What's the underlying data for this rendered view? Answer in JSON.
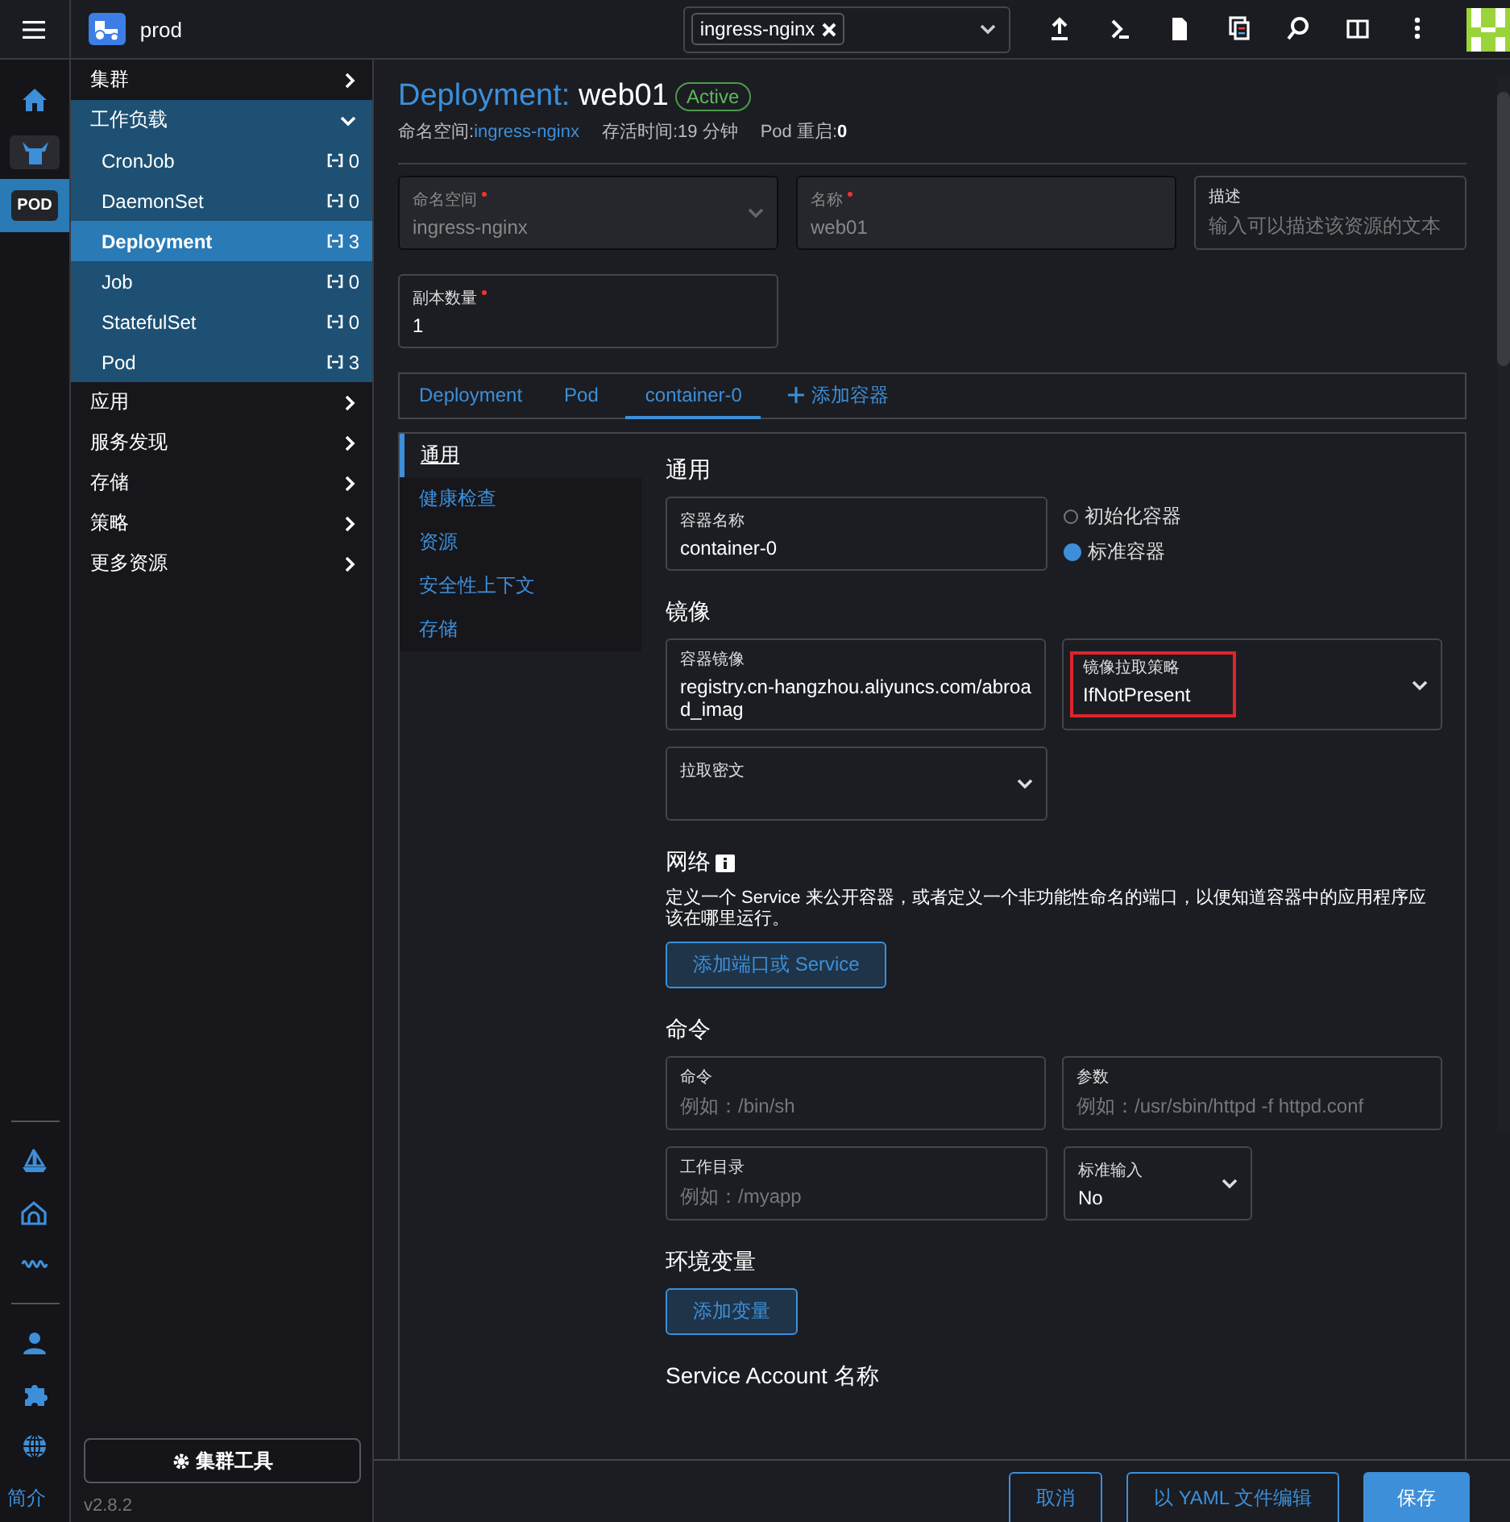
{
  "topbar": {
    "cluster": "prod",
    "namespace_chips": [
      "ingress-nginx"
    ]
  },
  "rail": {
    "pod_badge": {
      "label": "POD",
      "selected": true
    },
    "about_link": "简介"
  },
  "sidebar": {
    "groups": [
      {
        "label": "集群",
        "expanded": false
      },
      {
        "label": "工作负载",
        "expanded": true,
        "children": [
          {
            "label": "CronJob",
            "count": "0",
            "selected": false
          },
          {
            "label": "DaemonSet",
            "count": "0",
            "selected": false
          },
          {
            "label": "Deployment",
            "count": "3",
            "selected": true
          },
          {
            "label": "Job",
            "count": "0",
            "selected": false
          },
          {
            "label": "StatefulSet",
            "count": "0",
            "selected": false
          },
          {
            "label": "Pod",
            "count": "3",
            "selected": false
          }
        ]
      },
      {
        "label": "应用",
        "expanded": false
      },
      {
        "label": "服务发现",
        "expanded": false
      },
      {
        "label": "存储",
        "expanded": false
      },
      {
        "label": "策略",
        "expanded": false
      },
      {
        "label": "更多资源",
        "expanded": false
      }
    ],
    "tools_button": "集群工具",
    "version": "v2.8.2"
  },
  "header": {
    "kind_label": "Deployment:",
    "name": "web01",
    "status": "Active",
    "meta": [
      {
        "label": "命名空间:",
        "value": "ingress-nginx",
        "kind": "link"
      },
      {
        "label": "存活时间:",
        "value": "19 分钟",
        "kind": "plain"
      },
      {
        "label": "Pod 重启:",
        "value": "0",
        "kind": "bold"
      }
    ]
  },
  "form": {
    "fields": [
      {
        "kind": "select",
        "label": "命名空间",
        "required": true,
        "value": "ingress-nginx",
        "disabled": true
      },
      {
        "kind": "input",
        "label": "名称",
        "required": true,
        "value": "web01",
        "disabled": true
      },
      {
        "kind": "input",
        "label": "描述",
        "required": false,
        "placeholder": "输入可以描述该资源的文本",
        "disabled": false
      }
    ],
    "replicas": {
      "label": "副本数量",
      "required": true,
      "value": "1"
    }
  },
  "tabs": [
    {
      "label": "Deployment",
      "selected": false
    },
    {
      "label": "Pod",
      "selected": false
    },
    {
      "label": "container-0",
      "selected": true
    }
  ],
  "add_tab": "添加容器",
  "container": {
    "nav": [
      {
        "label": "通用",
        "selected": true
      },
      {
        "label": "健康检查",
        "selected": false
      },
      {
        "label": "资源",
        "selected": false
      },
      {
        "label": "安全性上下文",
        "selected": false
      },
      {
        "label": "存储",
        "selected": false
      }
    ],
    "sections": [
      {
        "heading": "通用",
        "rows": [
          [
            {
              "kind": "input",
              "label": "容器名称",
              "value": "container-0"
            },
            {
              "kind": "radio-group",
              "options": [
                {
                  "label": "初始化容器",
                  "selected": false
                },
                {
                  "label": "标准容器",
                  "selected": true
                }
              ]
            }
          ]
        ]
      },
      {
        "heading": "镜像",
        "rows": [
          [
            {
              "kind": "input",
              "label": "容器镜像",
              "value": "registry.cn-hangzhou.aliyuncs.com/abroad_imag"
            },
            {
              "kind": "select",
              "label": "镜像拉取策略",
              "value": "IfNotPresent",
              "highlighted": true
            }
          ],
          [
            {
              "kind": "select",
              "label": "拉取密文"
            }
          ]
        ]
      },
      {
        "heading": "网络",
        "info": true,
        "description": "定义一个 Service 来公开容器，或者定义一个非功能性命名的端口，以便知道容器中的应用程序应该在哪里运行。",
        "button": "添加端口或 Service"
      },
      {
        "heading": "命令",
        "rows": [
          [
            {
              "kind": "input",
              "label": "命令",
              "placeholder": "例如：/bin/sh"
            },
            {
              "kind": "input",
              "label": "参数",
              "placeholder": "例如：/usr/sbin/httpd -f httpd.conf"
            }
          ],
          [
            {
              "kind": "input",
              "label": "工作目录",
              "placeholder": "例如：/myapp"
            },
            {
              "kind": "compact-select",
              "label": "标准输入",
              "value": "No"
            }
          ]
        ]
      },
      {
        "heading": "环境变量",
        "button": "添加变量"
      },
      {
        "heading": "Service Account 名称"
      }
    ]
  },
  "footer": {
    "buttons": [
      {
        "label": "取消",
        "kind": "secondary"
      },
      {
        "label": "以 YAML 文件编辑",
        "kind": "secondary"
      },
      {
        "label": "保存",
        "kind": "primary"
      }
    ]
  }
}
